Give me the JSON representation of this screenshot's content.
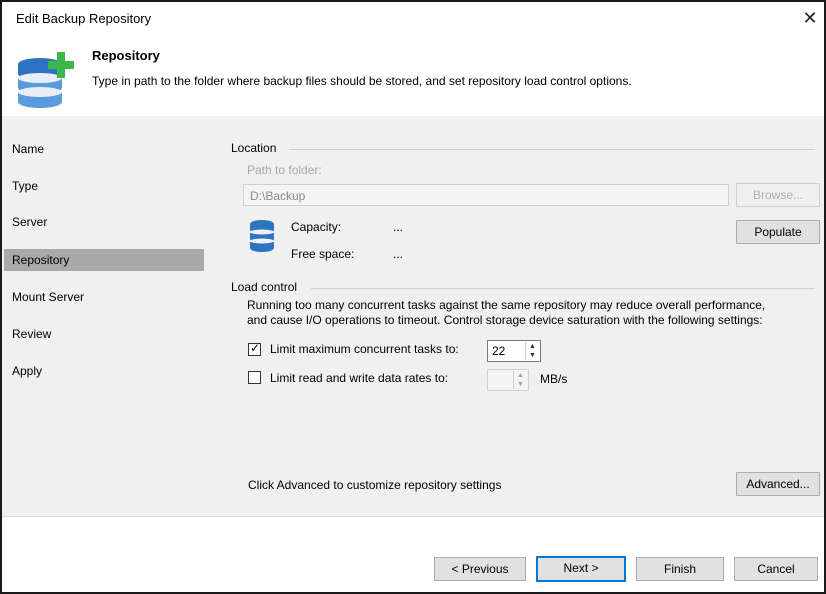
{
  "window": {
    "title": "Edit Backup Repository",
    "close_glyph": "✕"
  },
  "header": {
    "icon": "database-add-icon",
    "title": "Repository",
    "subtitle": "Type in path to the folder where backup files should be stored, and set repository load control options."
  },
  "sidebar": {
    "items": [
      {
        "label": "Name"
      },
      {
        "label": "Type"
      },
      {
        "label": "Server"
      },
      {
        "label": "Repository",
        "active": true
      },
      {
        "label": "Mount Server"
      },
      {
        "label": "Review"
      },
      {
        "label": "Apply"
      }
    ]
  },
  "location": {
    "group_title": "Location",
    "path_label": "Path to folder:",
    "path_value": "D:\\Backup",
    "browse_label": "Browse...",
    "capacity_label": "Capacity:",
    "capacity_value": "...",
    "free_space_label": "Free space:",
    "free_space_value": "...",
    "populate_label": "Populate",
    "storage_icon": "database-icon"
  },
  "load_control": {
    "group_title": "Load control",
    "description_line1": "Running too many concurrent tasks against the same repository may reduce overall performance,",
    "description_line2": "and cause I/O operations to timeout. Control storage device saturation with the following settings:",
    "limit_tasks_label": "Limit maximum concurrent tasks to:",
    "limit_tasks_checked": true,
    "limit_tasks_value": "22",
    "limit_rates_label": "Limit read and write data rates to:",
    "limit_rates_checked": false,
    "limit_rates_value": "",
    "limit_rates_unit": "MB/s",
    "check_glyph": "✓"
  },
  "advanced": {
    "hint": "Click Advanced to customize repository settings",
    "button_label": "Advanced..."
  },
  "footer": {
    "previous_label": "< Previous",
    "next_label": "Next >",
    "finish_label": "Finish",
    "cancel_label": "Cancel"
  },
  "colors": {
    "accent_green": "#3cb84a",
    "db_blue": "#2f74c0",
    "selected_sidebar": "#a9a9a9",
    "default_button_border": "#0078d7"
  }
}
